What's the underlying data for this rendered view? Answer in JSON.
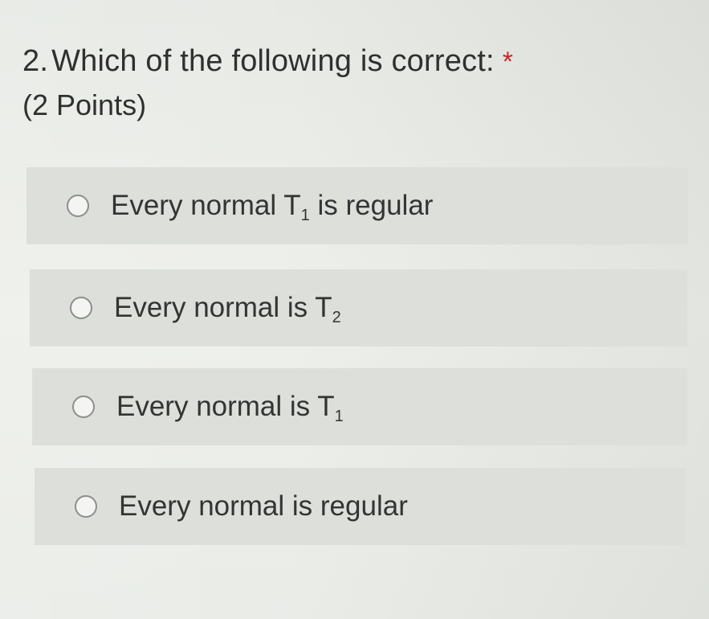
{
  "question": {
    "number": "2.",
    "text": "Which of the following is correct:",
    "required_marker": "*",
    "points": "(2 Points)"
  },
  "options": [
    {
      "prefix": "Every normal T",
      "subscript": "1",
      "suffix": " is regular",
      "selected": false
    },
    {
      "prefix": "Every normal is T",
      "subscript": "2",
      "suffix": "",
      "selected": false
    },
    {
      "prefix": "Every normal is T",
      "subscript": "1",
      "suffix": "",
      "selected": false
    },
    {
      "prefix": "Every normal is regular",
      "subscript": "",
      "suffix": "",
      "selected": false
    }
  ],
  "colors": {
    "background": "#e8ebe6",
    "option_background": "#dcdfda",
    "required_star": "#c62828",
    "text": "#2f302f"
  }
}
